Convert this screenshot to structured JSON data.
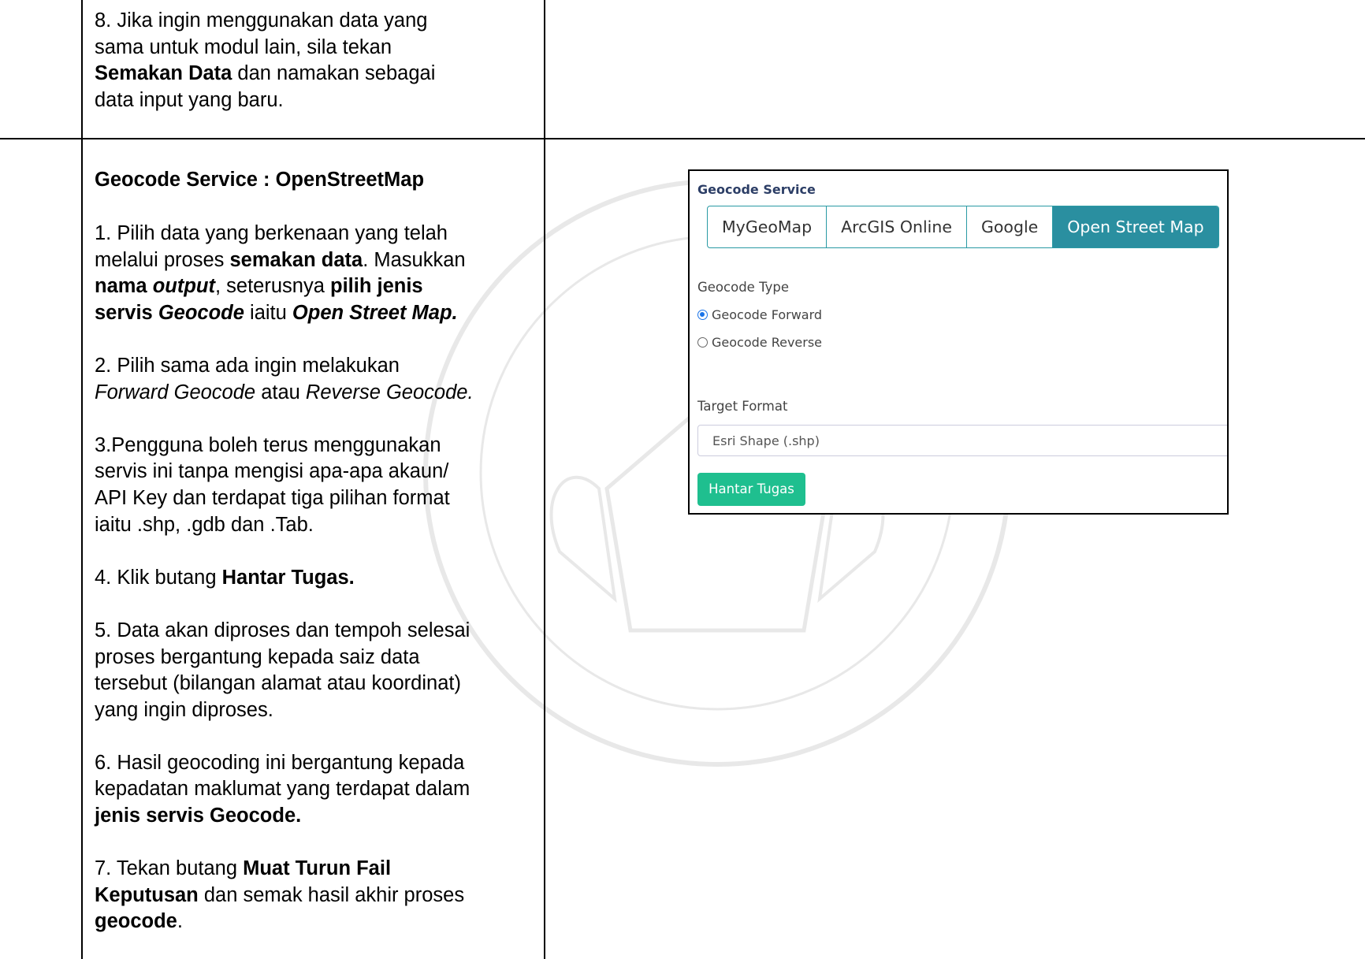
{
  "step8": {
    "l1": "8. Jika ingin menggunakan data yang",
    "l2": "sama untuk modul lain, sila tekan",
    "l3_bold": "Semakan Data",
    "l3_rest": " dan namakan sebagai",
    "l4": "data input yang baru."
  },
  "heading": "Geocode Service : OpenStreetMap",
  "s1": {
    "l1": "1. Pilih data yang berkenaan yang telah",
    "l2_a": "melalui proses ",
    "l2_b": "semakan data",
    "l2_c": ". Masukkan",
    "l3_a": "nama ",
    "l3_b": "output",
    "l3_c": ", seterusnya ",
    "l3_d": "pilih jenis",
    "l4_a": "servis ",
    "l4_b": "Geocode",
    "l4_c": " iaitu ",
    "l4_d": "Open Street Map."
  },
  "s2": {
    "l1": "2. Pilih sama ada ingin melakukan",
    "l2_a": "Forward Geocode",
    "l2_b": " atau ",
    "l2_c": "Reverse Geocode."
  },
  "s3": {
    "l1": "3.Pengguna boleh terus menggunakan",
    "l2": "servis ini tanpa mengisi apa-apa akaun/",
    "l3": "API Key dan terdapat tiga pilihan format",
    "l4": "iaitu .shp, .gdb dan .Tab."
  },
  "s4": {
    "a": "4. Klik butang ",
    "b": "Hantar Tugas."
  },
  "s5": {
    "l1": "5. Data akan diproses dan tempoh selesai",
    "l2": "proses bergantung kepada saiz data",
    "l3": "tersebut (bilangan alamat atau koordinat)",
    "l4": "yang ingin diproses."
  },
  "s6": {
    "l1": "6. Hasil geocoding ini bergantung kepada",
    "l2": "kepadatan maklumat yang terdapat dalam",
    "l3": "jenis servis Geocode."
  },
  "s7": {
    "l1_a": "7. Tekan butang ",
    "l1_b": "Muat Turun Fail",
    "l2_a": "Keputusan",
    "l2_b": " dan semak hasil akhir proses",
    "l3_a": "geocode",
    "l3_b": "."
  },
  "ui": {
    "title": "Geocode Service",
    "tabs": [
      "MyGeoMap",
      "ArcGIS Online",
      "Google",
      "Open Street Map"
    ],
    "geocode_type_label": "Geocode Type",
    "radio_forward": "Geocode Forward",
    "radio_reverse": "Geocode Reverse",
    "target_format_label": "Target Format",
    "target_format_value": "Esri Shape (.shp)",
    "submit": "Hantar Tugas"
  },
  "colors": {
    "accent": "#2a8fa0",
    "button": "#1fbf8f",
    "title": "#2c3e66"
  }
}
